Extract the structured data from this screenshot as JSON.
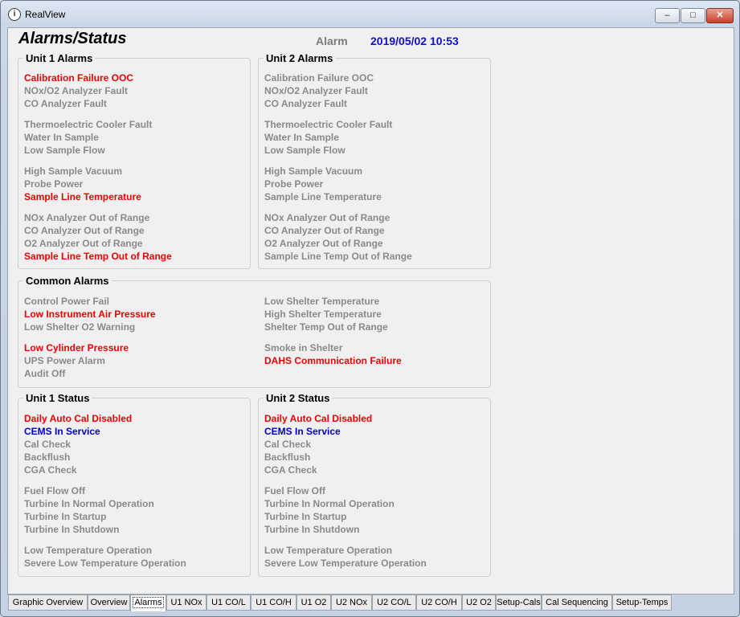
{
  "window": {
    "title": "RealView",
    "icon": "realview-icon"
  },
  "header": {
    "page_title": "Alarms/Status",
    "mode": "Alarm",
    "datetime": "2019/05/02 10:53"
  },
  "colors": {
    "alarm": "#ee0000",
    "normal": "#8a8a8a",
    "status_ok": "#0000c8",
    "datetime": "#1010c8"
  },
  "unit1_alarms": {
    "title": "Unit 1 Alarms",
    "items": [
      {
        "label": "Calibration Failure OOC",
        "state": "alarm"
      },
      {
        "label": "NOx/O2 Analyzer Fault",
        "state": "normal"
      },
      {
        "label": "CO Analyzer Fault",
        "state": "normal"
      },
      {
        "label": "Thermoelectric Cooler Fault",
        "state": "normal"
      },
      {
        "label": "Water In Sample",
        "state": "normal"
      },
      {
        "label": "Low Sample Flow",
        "state": "normal"
      },
      {
        "label": "High Sample Vacuum",
        "state": "normal"
      },
      {
        "label": "Probe Power",
        "state": "normal"
      },
      {
        "label": "Sample Line Temperature",
        "state": "alarm"
      },
      {
        "label": "NOx Analyzer Out of Range",
        "state": "normal"
      },
      {
        "label": "CO Analyzer Out of Range",
        "state": "normal"
      },
      {
        "label": "O2 Analyzer Out of Range",
        "state": "normal"
      },
      {
        "label": "Sample Line Temp Out of Range",
        "state": "alarm"
      }
    ]
  },
  "unit2_alarms": {
    "title": "Unit 2 Alarms",
    "items": [
      {
        "label": "Calibration Failure OOC",
        "state": "normal"
      },
      {
        "label": "NOx/O2 Analyzer Fault",
        "state": "normal"
      },
      {
        "label": "CO Analyzer Fault",
        "state": "normal"
      },
      {
        "label": "Thermoelectric Cooler Fault",
        "state": "normal"
      },
      {
        "label": "Water In Sample",
        "state": "normal"
      },
      {
        "label": "Low Sample Flow",
        "state": "normal"
      },
      {
        "label": "High Sample Vacuum",
        "state": "normal"
      },
      {
        "label": "Probe Power",
        "state": "normal"
      },
      {
        "label": "Sample Line Temperature",
        "state": "normal"
      },
      {
        "label": "NOx Analyzer Out of Range",
        "state": "normal"
      },
      {
        "label": "CO Analyzer Out of Range",
        "state": "normal"
      },
      {
        "label": "O2 Analyzer Out of Range",
        "state": "normal"
      },
      {
        "label": "Sample Line Temp Out of Range",
        "state": "normal"
      }
    ]
  },
  "common_alarms": {
    "title": "Common Alarms",
    "left": [
      {
        "label": "Control Power Fail",
        "state": "normal"
      },
      {
        "label": "Low Instrument Air Pressure",
        "state": "alarm"
      },
      {
        "label": "Low Shelter O2 Warning",
        "state": "normal"
      },
      {
        "label": "Low Cylinder Pressure",
        "state": "alarm"
      },
      {
        "label": "UPS Power Alarm",
        "state": "normal"
      },
      {
        "label": "Audit Off",
        "state": "normal"
      }
    ],
    "right": [
      {
        "label": "Low Shelter Temperature",
        "state": "normal"
      },
      {
        "label": "High Shelter Temperature",
        "state": "normal"
      },
      {
        "label": "Shelter Temp Out of Range",
        "state": "normal"
      },
      {
        "label": "Smoke in Shelter",
        "state": "normal"
      },
      {
        "label": "DAHS Communication Failure",
        "state": "alarm"
      }
    ]
  },
  "unit1_status": {
    "title": "Unit 1 Status",
    "items": [
      {
        "label": "Daily Auto Cal Disabled",
        "state": "alarm"
      },
      {
        "label": "CEMS In Service",
        "state": "ok"
      },
      {
        "label": "Cal Check",
        "state": "normal"
      },
      {
        "label": "Backflush",
        "state": "normal"
      },
      {
        "label": "CGA Check",
        "state": "normal"
      },
      {
        "label": "Fuel Flow Off",
        "state": "normal"
      },
      {
        "label": "Turbine In Normal Operation",
        "state": "normal"
      },
      {
        "label": "Turbine In Startup",
        "state": "normal"
      },
      {
        "label": "Turbine In Shutdown",
        "state": "normal"
      },
      {
        "label": "Low Temperature Operation",
        "state": "normal"
      },
      {
        "label": "Severe Low Temperature Operation",
        "state": "normal"
      }
    ]
  },
  "unit2_status": {
    "title": "Unit 2 Status",
    "items": [
      {
        "label": "Daily Auto Cal Disabled",
        "state": "alarm"
      },
      {
        "label": "CEMS In Service",
        "state": "ok"
      },
      {
        "label": "Cal Check",
        "state": "normal"
      },
      {
        "label": "Backflush",
        "state": "normal"
      },
      {
        "label": "CGA Check",
        "state": "normal"
      },
      {
        "label": "Fuel Flow Off",
        "state": "normal"
      },
      {
        "label": "Turbine In Normal Operation",
        "state": "normal"
      },
      {
        "label": "Turbine In Startup",
        "state": "normal"
      },
      {
        "label": "Turbine In Shutdown",
        "state": "normal"
      },
      {
        "label": "Low Temperature Operation",
        "state": "normal"
      },
      {
        "label": "Severe Low Temperature Operation",
        "state": "normal"
      }
    ]
  },
  "tabs": [
    {
      "label": "Graphic Overview",
      "active": false
    },
    {
      "label": "Overview",
      "active": false
    },
    {
      "label": "Alarms",
      "active": true
    },
    {
      "label": "U1 NOx",
      "active": false
    },
    {
      "label": "U1 CO/L",
      "active": false
    },
    {
      "label": "U1 CO/H",
      "active": false
    },
    {
      "label": "U1 O2",
      "active": false
    },
    {
      "label": "U2 NOx",
      "active": false
    },
    {
      "label": "U2 CO/L",
      "active": false
    },
    {
      "label": "U2 CO/H",
      "active": false
    },
    {
      "label": "U2 O2",
      "active": false
    },
    {
      "label": "Setup-Cals",
      "active": false
    },
    {
      "label": "Cal Sequencing",
      "active": false
    },
    {
      "label": "Setup-Temps",
      "active": false
    }
  ]
}
